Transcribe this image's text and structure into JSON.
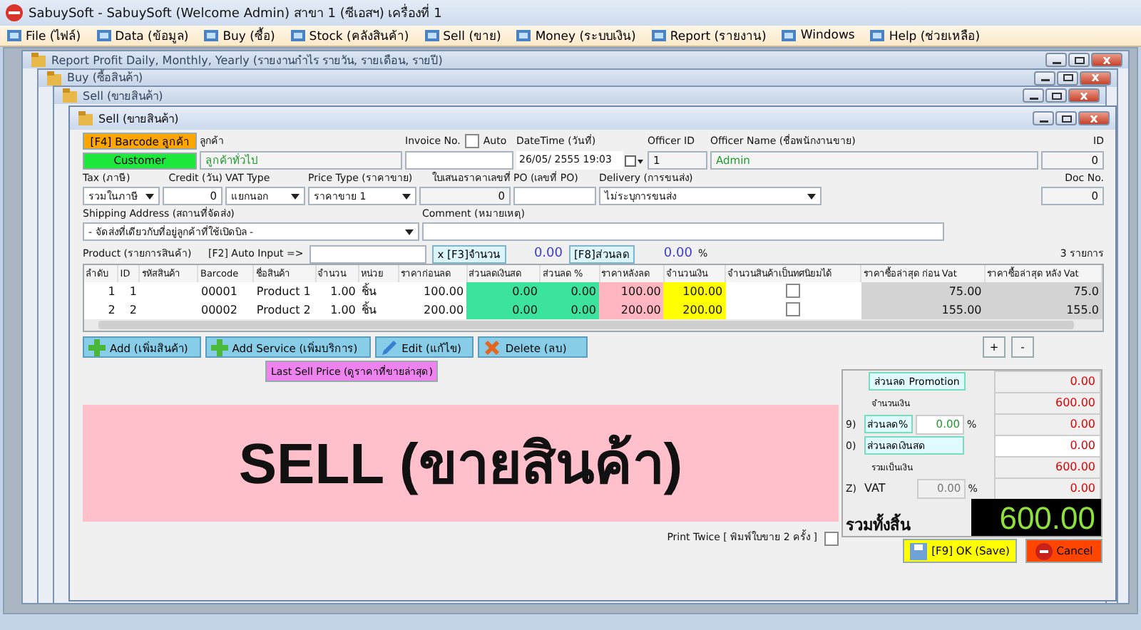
{
  "app_window": {
    "title": "SabuySoft - SabuySoft (Welcome Admin) สาขา 1 (ซีเอสฯ) เครื่องที่ 1"
  },
  "menu": [
    {
      "label": "File (ไฟล์)"
    },
    {
      "label": "Data (ข้อมูล)"
    },
    {
      "label": "Buy (ซื้อ)"
    },
    {
      "label": "Stock (คลังสินค้า)"
    },
    {
      "label": "Sell (ขาย)"
    },
    {
      "label": "Money (ระบบเงิน)"
    },
    {
      "label": "Report (รายงาน)"
    },
    {
      "label": "Windows"
    },
    {
      "label": "Help (ช่วยเหลือ)"
    }
  ],
  "background_windows": [
    {
      "title": "Report Profit Daily, Monthly, Yearly (รายงานกำไร รายวัน, รายเดือน, รายปี)"
    },
    {
      "title": "Buy (ซื้อสินค้า)"
    },
    {
      "title": "Sell (ขายสินค้า)"
    }
  ],
  "sell_window": {
    "title": "Sell (ขายสินค้า)",
    "barcode_button": "[F4] Barcode ลูกค้า",
    "customer_button": "Customer",
    "customer": {
      "label": "ลูกค้า",
      "value": "ลูกค้าทั่วไป"
    },
    "invoice_no": {
      "label": "Invoice No."
    },
    "auto": {
      "label": "Auto",
      "checked": false
    },
    "datetime": {
      "label": "DateTime (วันที่)",
      "value": "26/05/ 2555 19:03"
    },
    "officer_id": {
      "label": "Officer ID",
      "value": "1"
    },
    "officer_name": {
      "label": "Officer Name (ชื่อพนักงานขาย)",
      "value": "Admin"
    },
    "id": {
      "label": "ID",
      "value": "0"
    },
    "tax": {
      "label": "Tax (ภาษี)",
      "value": "รวมในภาษี"
    },
    "credit": {
      "label": "Credit (วัน)",
      "value": "0"
    },
    "vat_type": {
      "label": "VAT Type",
      "value": "แยกนอก"
    },
    "price_type": {
      "label": "Price Type (ราคาขาย)",
      "value": "ราคาขาย 1"
    },
    "quotation_no": {
      "label": "ใบเสนอราคาเลขที่",
      "value": "0"
    },
    "po": {
      "label": "PO (เลขที่ PO)"
    },
    "delivery": {
      "label": "Delivery (การขนส่ง)",
      "value": "ไม่ระบุการขนส่ง"
    },
    "doc_no": {
      "label": "Doc No.",
      "value": "0"
    },
    "shipping_address": {
      "label": "Shipping Address (สถานที่จัดส่ง)",
      "value": "- จัดส่งที่เดียวกับที่อยู่ลูกค้าที่ใช้เปิดบิล -"
    },
    "comment": {
      "label": "Comment (หมายเหตุ)"
    },
    "product_label": "Product (รายการสินค้า)",
    "auto_input": {
      "label": "[F2] Auto Input =>"
    },
    "qty_button": "x [F3]จำนวน",
    "qty_value": "0.00",
    "discount_button": "[F8]ส่วนลด",
    "discount_value": "0.00",
    "discount_unit": "%",
    "item_count": "3 รายการ",
    "table": {
      "columns": [
        {
          "label": "ลำดับ",
          "kind": "number"
        },
        {
          "label": "ID",
          "kind": "number"
        },
        {
          "label": "รหัสสินค้า",
          "kind": "text"
        },
        {
          "label": "Barcode",
          "kind": "text"
        },
        {
          "label": "ชื่อสินค้า",
          "kind": "text"
        },
        {
          "label": "จำนวน",
          "kind": "number"
        },
        {
          "label": "หน่วย",
          "kind": "text"
        },
        {
          "label": "ราคาก่อนลด",
          "kind": "number"
        },
        {
          "label": "ส่วนลดเงินสด",
          "kind": "number",
          "color": "#3ce39c"
        },
        {
          "label": "ส่วนลด %",
          "kind": "number",
          "color": "#3ce39c"
        },
        {
          "label": "ราคาหลังลด",
          "kind": "number",
          "color": "#ffb6c1"
        },
        {
          "label": "จำนวนเงิน",
          "kind": "number",
          "color": "#ffff00"
        },
        {
          "label": "จำนวนสินค้าเป็นทศนิยมได้",
          "kind": "checkbox"
        },
        {
          "label": "ราคาซื้อล่าสุด ก่อน Vat",
          "kind": "number",
          "color": "#d3d3d3"
        },
        {
          "label": "ราคาซื้อล่าสุด หลัง Vat",
          "kind": "number",
          "color": "#d3d3d3"
        }
      ],
      "rows": [
        {
          "cells": [
            "1",
            "1",
            null,
            "00001",
            "Product 1",
            "1.00",
            "ชิ้น",
            "100.00",
            "0.00",
            "0.00",
            "100.00",
            "100.00",
            false,
            "75.00",
            "75.0"
          ]
        },
        {
          "cells": [
            "2",
            "2",
            null,
            "00002",
            "Product 2",
            "1.00",
            "ชิ้น",
            "200.00",
            "0.00",
            "0.00",
            "200.00",
            "200.00",
            false,
            "155.00",
            "155.0"
          ]
        }
      ]
    },
    "item_buttons": [
      {
        "label": "Add (เพิ่มสินค้า)",
        "kind": "add"
      },
      {
        "label": "Add Service (เพิ่มบริการ)",
        "kind": "add"
      },
      {
        "label": "Edit (แก้ไข)",
        "kind": "edit"
      },
      {
        "label": "Delete (ลบ)",
        "kind": "delete"
      }
    ],
    "row_buttons": [
      "+",
      "-"
    ],
    "last_sell_price_button": "Last Sell Price (ดูราคาที่ขายล่าสุด)",
    "banner": "SELL (ขายสินค้า)",
    "summary": {
      "promotion": {
        "label": "ส่วนลด Promotion",
        "value": "0.00"
      },
      "subtotal": {
        "label": "จำนวนเงิน",
        "value": "600.00"
      },
      "discount_pct": {
        "key": "9)",
        "label": "ส่วนลด%",
        "rate": "0.00",
        "unit": "%",
        "value": "0.00"
      },
      "cash_discount": {
        "key": "0)",
        "label": "ส่วนลดเงินสด",
        "value": "0.00"
      },
      "total": {
        "label": "รวมเป็นเงิน",
        "value": "600.00"
      },
      "vat": {
        "key": "Z)",
        "label": "VAT",
        "rate": "0.00",
        "unit": "%",
        "value": "0.00"
      },
      "grand_total": {
        "label": "รวมทั้งสิ้น",
        "value": "600.00"
      }
    },
    "print_twice": {
      "label": "Print Twice [ พิมพ์ใบขาย 2 ครั้ง ]",
      "checked": false
    },
    "ok_button": "[F9] OK (Save)",
    "cancel_button": "Cancel"
  }
}
